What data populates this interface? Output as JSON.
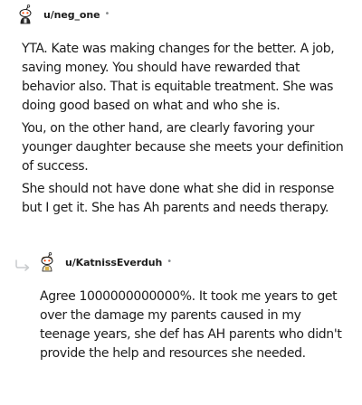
{
  "comment1": {
    "username": "u/neg_one",
    "dot": "•",
    "paragraphs": [
      "YTA. Kate was making changes for the better. A job, saving money. You should have rewarded that behavior also. That is equitable treatment. She was doing good based on what and who she is.",
      "You, on the other hand, are clearly favoring your younger daughter because she meets your definition of success.",
      "She should not have done what she did in response but I get it. She has Ah parents and needs therapy."
    ]
  },
  "comment2": {
    "username": "u/KatnissEverduh",
    "dot": "•",
    "paragraphs": [
      "Agree 1000000000000%. It took me years to get over the damage my parents caused in my teenage years, she def has AH parents who didn't provide the help and resources she needed."
    ]
  },
  "icons": {
    "avatar1": "snoo-avatar-icon",
    "avatar2": "snoo-avatar-icon",
    "reply": "reply-arrow-icon"
  },
  "colors": {
    "text": "#1c1c1c",
    "meta": "#878a8c",
    "reply_line": "#c8cbcd"
  }
}
